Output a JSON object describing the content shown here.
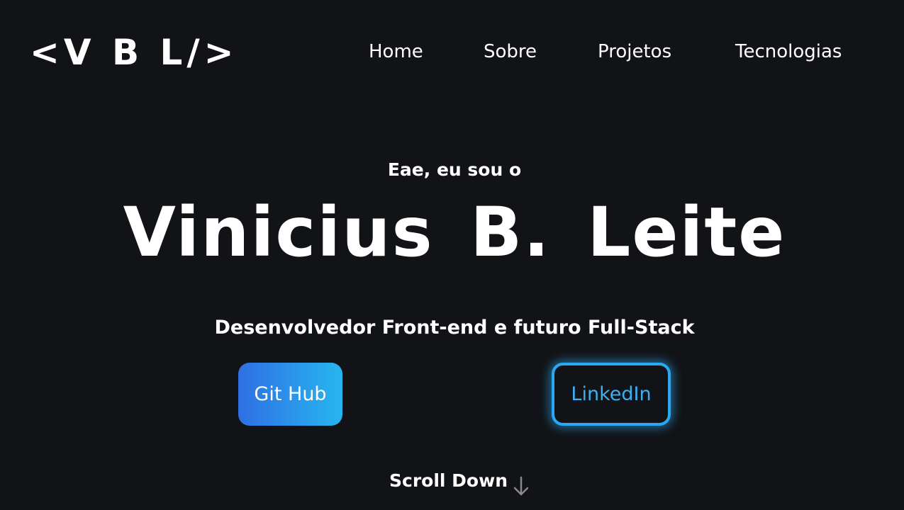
{
  "header": {
    "logo": "<V B L/>",
    "nav": {
      "home": "Home",
      "sobre": "Sobre",
      "projetos": "Projetos",
      "tecnologias": "Tecnologias"
    }
  },
  "hero": {
    "greeting": "Eae, eu sou o",
    "name": "Vinicius B. Leite",
    "subtitle": "Desenvolvedor Front-end e futuro Full-Stack",
    "buttons": {
      "github": "Git Hub",
      "linkedin": "LinkedIn"
    },
    "scroll": {
      "label": "Scroll Down",
      "icon": "arrow-down-icon"
    }
  },
  "colors": {
    "background": "#121316",
    "text": "#ffffff",
    "accent_start": "#2f6fe4",
    "accent_end": "#27b6ee",
    "linkedin_border": "#2aa9f2",
    "scroll_icon": "#8a8a8a"
  }
}
